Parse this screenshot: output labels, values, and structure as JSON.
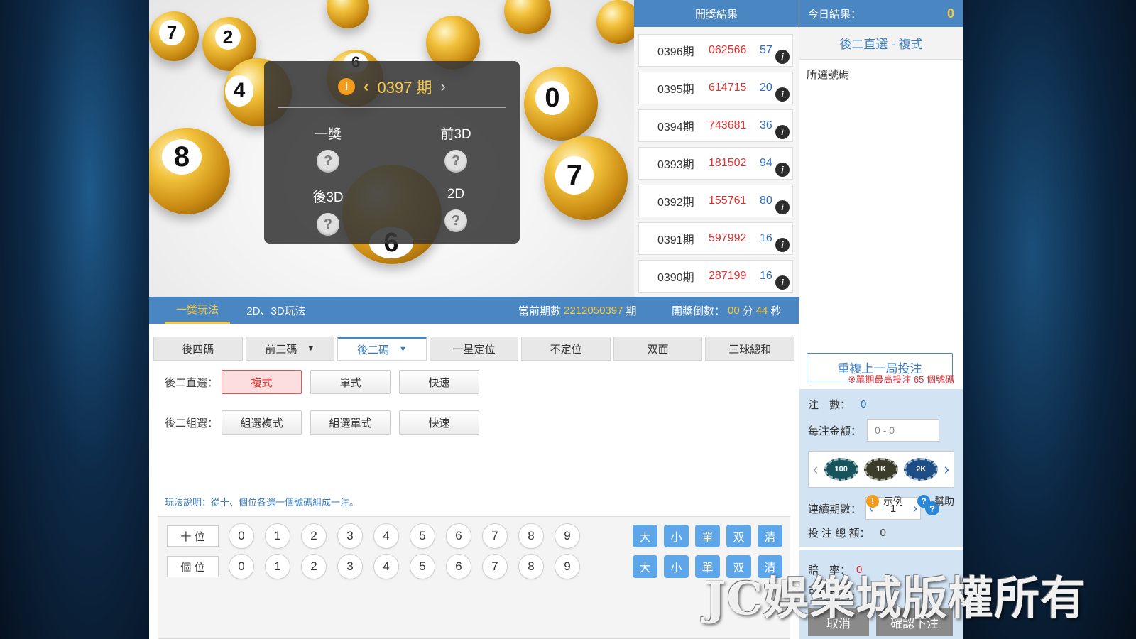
{
  "hero": {
    "current_period": "0397 期",
    "prize_labels": [
      "一獎",
      "前3D",
      "後3D",
      "2D"
    ],
    "ball_numbers": [
      "7",
      "2",
      "4",
      "8",
      "6",
      "6",
      "0",
      "7"
    ]
  },
  "results": {
    "title": "開獎結果",
    "rows": [
      {
        "period": "0396期",
        "number": "062566",
        "sum": "57"
      },
      {
        "period": "0395期",
        "number": "614715",
        "sum": "20"
      },
      {
        "period": "0394期",
        "number": "743681",
        "sum": "36"
      },
      {
        "period": "0393期",
        "number": "181502",
        "sum": "94"
      },
      {
        "period": "0392期",
        "number": "155761",
        "sum": "80"
      },
      {
        "period": "0391期",
        "number": "597992",
        "sum": "16"
      },
      {
        "period": "0390期",
        "number": "287199",
        "sum": "16"
      }
    ]
  },
  "sidebar": {
    "today_label": "今日結果：",
    "today_value": "0",
    "mode_title": "後二直選 - 複式",
    "picked_label": "所選號碼",
    "repeat_label": "重複上一局投注",
    "count_label": "注　數：",
    "count_value": "0",
    "amount_label": "每注金額：",
    "amount_placeholder": "0 - 0",
    "chips": [
      "100",
      "1K",
      "2K"
    ],
    "chip_colors": [
      "#16535a",
      "#3b3c2a",
      "#1e4e86"
    ],
    "periods_label": "連續期數：",
    "periods_value": "1",
    "total_label": "投 注 總 額：",
    "total_value": "0",
    "odds_label": "賠　率：",
    "odds_value": "0",
    "win_label": "可贏金額：",
    "cancel_label": "取消",
    "confirm_label": "確認下注"
  },
  "tabbar": {
    "tabs": [
      "一獎玩法",
      "2D、3D玩法"
    ],
    "current_label": "當前期數",
    "current_value": "2212050397",
    "current_unit": "期",
    "countdown_label": "開獎倒數：",
    "countdown_min": "00",
    "countdown_min_unit": "分",
    "countdown_sec": "44",
    "countdown_sec_unit": "秒"
  },
  "subtabs": [
    "後四碼",
    "前三碼",
    "後二碼",
    "一星定位",
    "不定位",
    "双面",
    "三球總和"
  ],
  "modes": {
    "direct_label": "後二直選：",
    "direct_buttons": [
      "複式",
      "單式",
      "快速"
    ],
    "group_label": "後二組選：",
    "group_buttons": [
      "組選複式",
      "組選單式",
      "快速"
    ],
    "notice": "※單期最高投注 65 個號碼"
  },
  "description": {
    "text": "玩法說明：從十、個位各選一個號碼組成一注。",
    "example_label": "示例",
    "help_label": "幫助"
  },
  "picker": {
    "positions": [
      "十 位",
      "個 位"
    ],
    "digits": [
      "0",
      "1",
      "2",
      "3",
      "4",
      "5",
      "6",
      "7",
      "8",
      "9"
    ],
    "quick": [
      "大",
      "小",
      "單",
      "双",
      "清"
    ]
  },
  "watermark": "JC娛樂城版權所有",
  "colors": {
    "accent": "#4a86c2",
    "highlight": "#f5c842",
    "red": "#e23030"
  }
}
